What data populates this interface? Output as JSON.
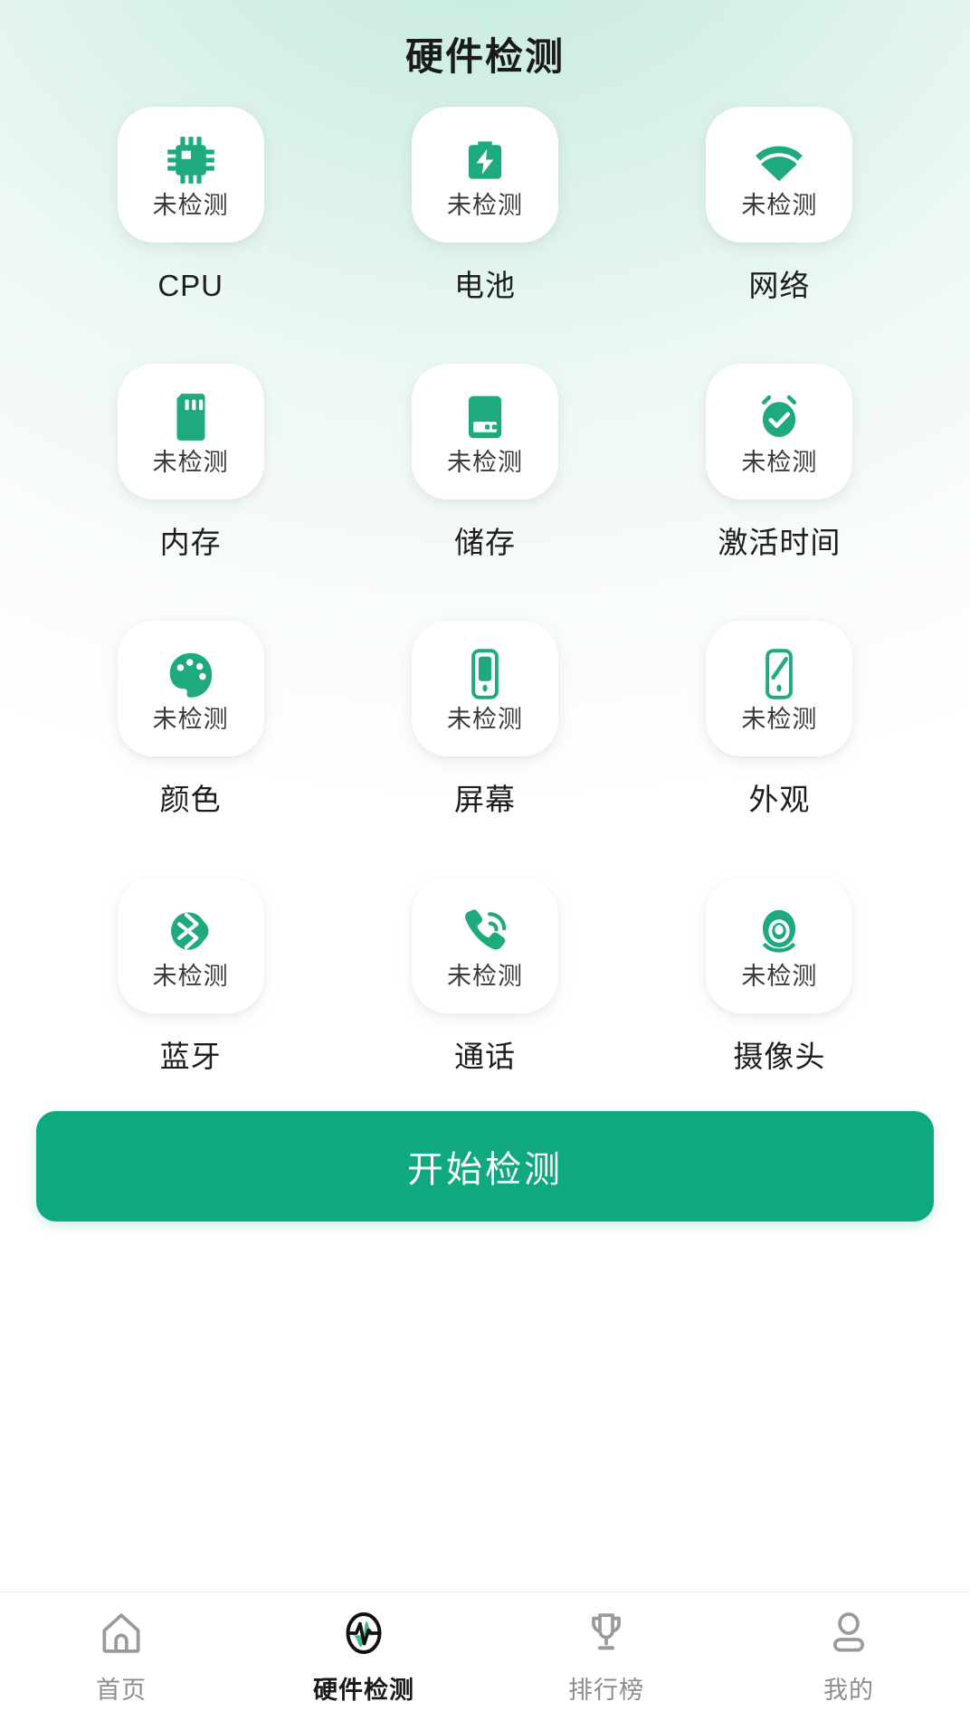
{
  "header": {
    "title": "硬件检测"
  },
  "colors": {
    "accent": "#10a87e",
    "icon_green": "#1fa97f",
    "card_bg": "#ffffff",
    "status_text": "#3a3a3a",
    "label_text": "#1d1d1d",
    "tab_inactive": "#8d8d8d",
    "tab_active": "#1a1a1a",
    "bg_top": "#cdeee1",
    "bg_bottom": "#ffffff"
  },
  "grid": {
    "status_default": "未检测",
    "items": [
      {
        "label": "CPU",
        "status": "未检测",
        "icon": "cpu-chip-icon"
      },
      {
        "label": "电池",
        "status": "未检测",
        "icon": "battery-bolt-icon"
      },
      {
        "label": "网络",
        "status": "未检测",
        "icon": "wifi-icon"
      },
      {
        "label": "内存",
        "status": "未检测",
        "icon": "memory-card-icon"
      },
      {
        "label": "储存",
        "status": "未检测",
        "icon": "hard-drive-icon"
      },
      {
        "label": "激活时间",
        "status": "未检测",
        "icon": "alarm-check-icon"
      },
      {
        "label": "颜色",
        "status": "未检测",
        "icon": "palette-icon"
      },
      {
        "label": "屏幕",
        "status": "未检测",
        "icon": "phone-screen-icon"
      },
      {
        "label": "外观",
        "status": "未检测",
        "icon": "phone-appearance-icon"
      },
      {
        "label": "蓝牙",
        "status": "未检测",
        "icon": "bluetooth-icon"
      },
      {
        "label": "通话",
        "status": "未检测",
        "icon": "phone-call-icon"
      },
      {
        "label": "摄像头",
        "status": "未检测",
        "icon": "camera-icon"
      }
    ]
  },
  "cta": {
    "label": "开始检测"
  },
  "tabbar": {
    "items": [
      {
        "label": "首页",
        "icon": "home-icon",
        "active": false
      },
      {
        "label": "硬件检测",
        "icon": "pulse-icon",
        "active": true
      },
      {
        "label": "排行榜",
        "icon": "trophy-icon",
        "active": false
      },
      {
        "label": "我的",
        "icon": "person-icon",
        "active": false
      }
    ]
  }
}
